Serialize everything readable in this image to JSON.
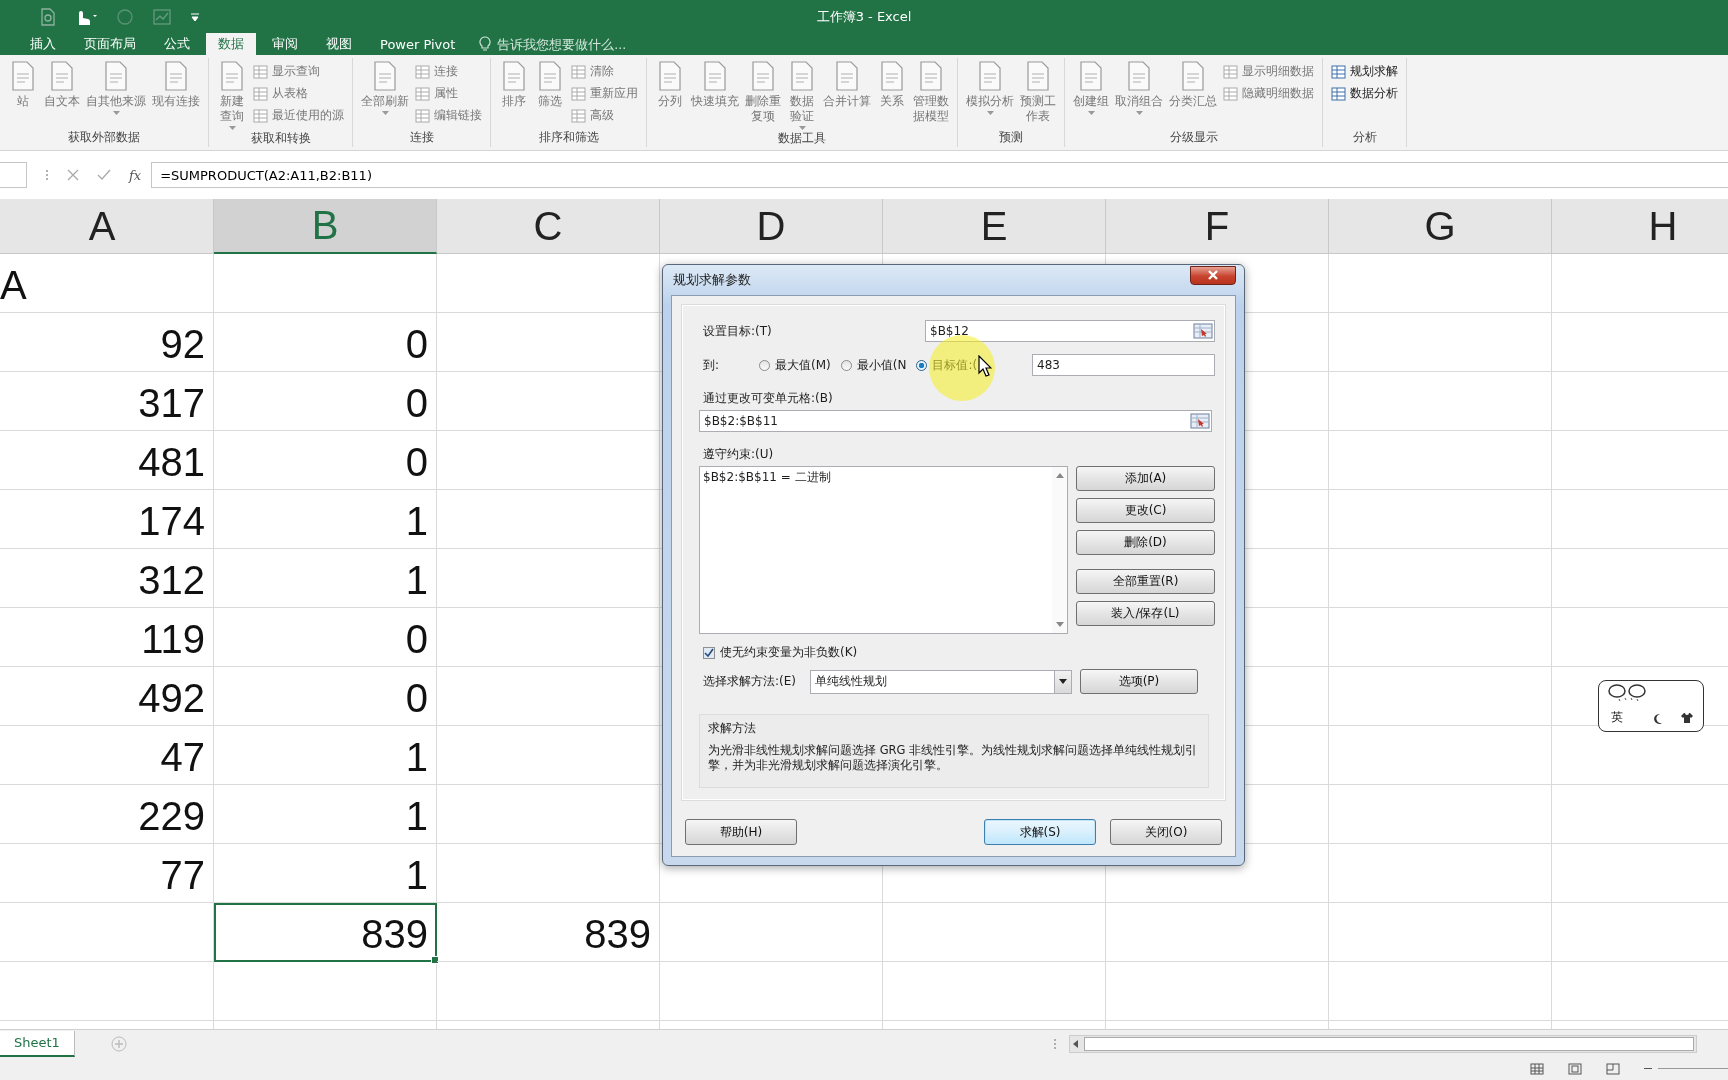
{
  "window": {
    "title": "工作簿3 - Excel"
  },
  "ribbon_tabs": [
    {
      "label": "插入",
      "selected": false
    },
    {
      "label": "页面布局",
      "selected": false
    },
    {
      "label": "公式",
      "selected": false
    },
    {
      "label": "数据",
      "selected": true
    },
    {
      "label": "审阅",
      "selected": false
    },
    {
      "label": "视图",
      "selected": false
    },
    {
      "label": "Power Pivot",
      "selected": false
    }
  ],
  "tell_me": {
    "placeholder": "告诉我您想要做什么..."
  },
  "ribbon_groups": [
    {
      "label": "获取外部数据",
      "commands": [
        {
          "label": "站",
          "kind": "large",
          "dropdown": false,
          "disabled": true
        },
        {
          "label": "自文本",
          "kind": "large",
          "dropdown": false,
          "disabled": true
        },
        {
          "label": "自其他来源",
          "kind": "large",
          "dropdown": true,
          "disabled": true
        },
        {
          "label": "现有连接",
          "kind": "large",
          "dropdown": false,
          "disabled": true
        }
      ]
    },
    {
      "label": "获取和转换",
      "commands": [
        {
          "label": "新建查询",
          "kind": "large",
          "dropdown": true,
          "wrap": true,
          "disabled": true
        },
        {
          "label": "显示查询",
          "kind": "small",
          "dropdown": false,
          "disabled": true
        },
        {
          "label": "从表格",
          "kind": "small",
          "dropdown": false,
          "disabled": true
        },
        {
          "label": "最近使用的源",
          "kind": "small",
          "dropdown": false,
          "disabled": true
        }
      ]
    },
    {
      "label": "连接",
      "commands": [
        {
          "label": "全部刷新",
          "kind": "large",
          "dropdown": true,
          "disabled": true
        },
        {
          "label": "连接",
          "kind": "small",
          "dropdown": false,
          "disabled": true
        },
        {
          "label": "属性",
          "kind": "small",
          "dropdown": false,
          "disabled": true
        },
        {
          "label": "编辑链接",
          "kind": "small",
          "dropdown": false,
          "disabled": true
        }
      ]
    },
    {
      "label": "排序和筛选",
      "commands": [
        {
          "label": "排序",
          "kind": "large",
          "dropdown": false,
          "disabled": true
        },
        {
          "label": "筛选",
          "kind": "large",
          "dropdown": false,
          "disabled": true
        },
        {
          "label": "清除",
          "kind": "small",
          "dropdown": false,
          "disabled": true
        },
        {
          "label": "重新应用",
          "kind": "small",
          "dropdown": false,
          "disabled": true
        },
        {
          "label": "高级",
          "kind": "small",
          "dropdown": false,
          "disabled": true
        }
      ]
    },
    {
      "label": "数据工具",
      "commands": [
        {
          "label": "分列",
          "kind": "large",
          "dropdown": false,
          "disabled": true
        },
        {
          "label": "快速填充",
          "kind": "large",
          "dropdown": false,
          "disabled": true
        },
        {
          "label": "删除重复项",
          "kind": "large",
          "dropdown": false,
          "wrap": true,
          "disabled": true
        },
        {
          "label": "数据验证",
          "kind": "large",
          "dropdown": true,
          "wrap": true,
          "disabled": true
        },
        {
          "label": "合并计算",
          "kind": "large",
          "dropdown": false,
          "disabled": true
        },
        {
          "label": "关系",
          "kind": "large",
          "dropdown": false,
          "disabled": true
        },
        {
          "label": "管理数据模型",
          "kind": "large",
          "dropdown": false,
          "wrap": true,
          "disabled": true
        }
      ]
    },
    {
      "label": "预测",
      "commands": [
        {
          "label": "模拟分析",
          "kind": "large",
          "dropdown": true,
          "disabled": true
        },
        {
          "label": "预测工作表",
          "kind": "large",
          "dropdown": false,
          "wrap": true,
          "disabled": true
        }
      ]
    },
    {
      "label": "分级显示",
      "commands": [
        {
          "label": "创建组",
          "kind": "large",
          "dropdown": true,
          "disabled": true
        },
        {
          "label": "取消组合",
          "kind": "large",
          "dropdown": true,
          "disabled": true
        },
        {
          "label": "分类汇总",
          "kind": "large",
          "dropdown": false,
          "disabled": true
        },
        {
          "label": "显示明细数据",
          "kind": "small",
          "dropdown": false,
          "disabled": true
        },
        {
          "label": "隐藏明细数据",
          "kind": "small",
          "dropdown": false,
          "disabled": true
        }
      ]
    },
    {
      "label": "分析",
      "commands": [
        {
          "label": "规划求解",
          "kind": "small",
          "dropdown": false,
          "disabled": false
        },
        {
          "label": "数据分析",
          "kind": "small",
          "dropdown": false,
          "disabled": false
        }
      ]
    }
  ],
  "formula_bar": {
    "function_label": "fx",
    "formula": "=SUMPRODUCT(A2:A11,B2:B11)"
  },
  "columns": [
    {
      "label": "A",
      "selected": false
    },
    {
      "label": "B",
      "selected": true
    },
    {
      "label": "C",
      "selected": false
    },
    {
      "label": "D",
      "selected": false
    },
    {
      "label": "E",
      "selected": false
    },
    {
      "label": "F",
      "selected": false
    },
    {
      "label": "G",
      "selected": false
    },
    {
      "label": "H",
      "selected": false
    }
  ],
  "rows": [
    {
      "a": {
        "text": "A",
        "kind": "text",
        "selected": false
      }
    },
    {
      "a": {
        "text": "92",
        "kind": "number",
        "selected": false
      },
      "b": {
        "text": "0",
        "kind": "number",
        "selected": false
      }
    },
    {
      "a": {
        "text": "317",
        "kind": "number",
        "selected": false
      },
      "b": {
        "text": "0",
        "kind": "number",
        "selected": false
      }
    },
    {
      "a": {
        "text": "481",
        "kind": "number",
        "selected": false
      },
      "b": {
        "text": "0",
        "kind": "number",
        "selected": false
      }
    },
    {
      "a": {
        "text": "174",
        "kind": "number",
        "selected": false
      },
      "b": {
        "text": "1",
        "kind": "number",
        "selected": false
      }
    },
    {
      "a": {
        "text": "312",
        "kind": "number",
        "selected": false
      },
      "b": {
        "text": "1",
        "kind": "number",
        "selected": false
      }
    },
    {
      "a": {
        "text": "119",
        "kind": "number",
        "selected": false
      },
      "b": {
        "text": "0",
        "kind": "number",
        "selected": false
      }
    },
    {
      "a": {
        "text": "492",
        "kind": "number",
        "selected": false
      },
      "b": {
        "text": "0",
        "kind": "number",
        "selected": false
      }
    },
    {
      "a": {
        "text": "47",
        "kind": "number",
        "selected": false
      },
      "b": {
        "text": "1",
        "kind": "number",
        "selected": false
      }
    },
    {
      "a": {
        "text": "229",
        "kind": "number",
        "selected": false
      },
      "b": {
        "text": "1",
        "kind": "number",
        "selected": false
      }
    },
    {
      "a": {
        "text": "77",
        "kind": "number",
        "selected": false
      },
      "b": {
        "text": "1",
        "kind": "number",
        "selected": false
      }
    },
    {
      "b": {
        "text": "839",
        "kind": "number",
        "selected": true
      },
      "c": {
        "text": "839",
        "kind": "number",
        "selected": false
      }
    }
  ],
  "sheet_tabs": [
    {
      "label": "Sheet1",
      "selected": true
    }
  ],
  "ime_toolbar": {
    "label": "英"
  },
  "solver_dialog": {
    "title": "规划求解参数",
    "objective": {
      "label": "设置目标:(T)",
      "value": "$B$12"
    },
    "to": {
      "label": "到:",
      "options": [
        {
          "label": "最大值(M)",
          "selected": false
        },
        {
          "label": "最小值(N",
          "selected": false
        },
        {
          "label": "目标值:(",
          "selected": true
        }
      ],
      "value": "483"
    },
    "variables": {
      "label": "通过更改可变单元格:(B)",
      "value": "$B$2:$B$11"
    },
    "constraints": {
      "label": "遵守约束:(U)",
      "items": [
        "$B$2:$B$11 = 二进制"
      ],
      "buttons": [
        "添加(A)",
        "更改(C)",
        "删除(D)",
        "全部重置(R)",
        "装入/保存(L)"
      ]
    },
    "nonnegative": {
      "label": "使无约束变量为非负数(K)",
      "checked": true
    },
    "method": {
      "label": "选择求解方法:(E)",
      "value": "单纯线性规划",
      "options_button": "选项(P)"
    },
    "description": {
      "title": "求解方法",
      "text": "为光滑非线性规划求解问题选择 GRG 非线性引擎。为线性规划求解问题选择单纯线性规划引擎，并为非光滑规划求解问题选择演化引擎。"
    },
    "buttons": [
      {
        "label": "帮助(H)",
        "default": false
      },
      {
        "label": "求解(S)",
        "default": true
      },
      {
        "label": "关闭(O)",
        "default": false
      }
    ]
  }
}
